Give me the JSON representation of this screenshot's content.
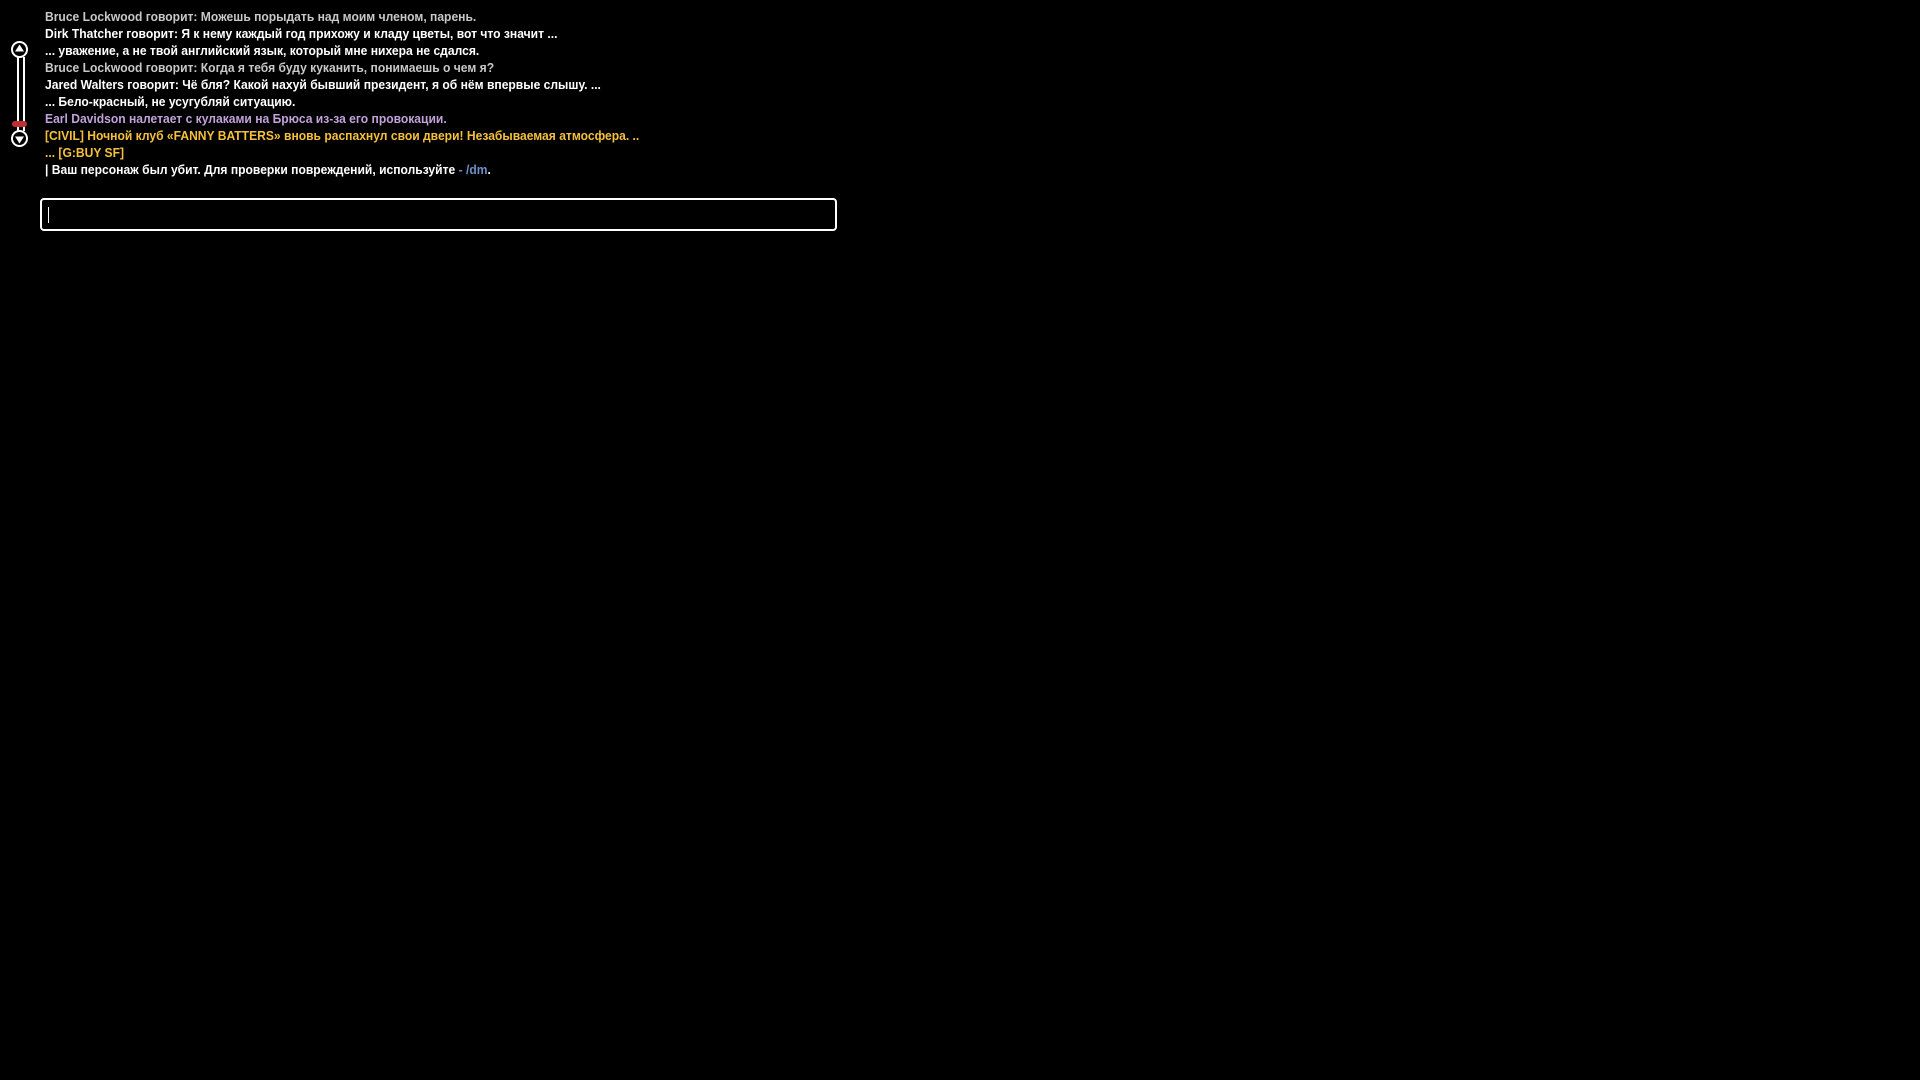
{
  "colors": {
    "background": "#000000",
    "say_grey": "#c8c8c8",
    "say_white": "#ffffff",
    "action_purple": "#c2a2da",
    "civil_yellow": "#f5c13c",
    "command_blue": "#6f8fc5",
    "scroll_thumb_red": "#c03030"
  },
  "scrollbar": {
    "up_icon": "arrow-up-icon",
    "down_icon": "arrow-down-icon"
  },
  "chat": {
    "lines": [
      {
        "text": "Bruce Lockwood говорит: Можешь порыдать над моим членом, парень.",
        "color": "grey"
      },
      {
        "text": "Dirk Thatcher говорит: Я к нему каждый год прихожу и кладу цветы, вот что значит ...",
        "color": "white"
      },
      {
        "text": "... уважение, а не твой английский язык, который мне нихера не сдался.",
        "color": "white"
      },
      {
        "text": "Bruce Lockwood говорит: Когда я тебя буду куканить, понимаешь о чем я?",
        "color": "grey"
      },
      {
        "text": "Jared Walters говорит: Чё бля? Какой нахуй бывший президент, я об нём впервые слышу. ...",
        "color": "white"
      },
      {
        "text": "... Бело-красный, не усугубляй ситуацию.",
        "color": "white"
      },
      {
        "text": "Earl Davidson налетает с кулаками на Брюса из-за его провокации.",
        "color": "purple"
      },
      {
        "text": "[CIVIL] Ночной клуб «FANNY BATTERS» вновь распахнул свои двери! Незабываемая атмосфера. ..",
        "color": "yellow"
      },
      {
        "text": "... [G:BUY SF]",
        "color": "yellow"
      }
    ],
    "death_notice": {
      "prefix": "| Ваш персонаж был убит. Для проверки повреждений, используйте",
      "dash": " - ",
      "command": "/dm",
      "suffix": "."
    }
  },
  "input": {
    "value": ""
  }
}
